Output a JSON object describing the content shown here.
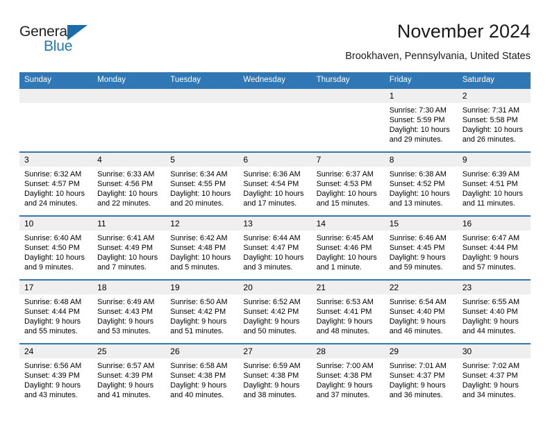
{
  "logo": {
    "word_top": "General",
    "word_bottom": "Blue",
    "triangle_color": "#1b6cab",
    "blue_color": "#2077b8",
    "dark_color": "#231f20"
  },
  "header": {
    "title": "November 2024",
    "subtitle": "Brookhaven, Pennsylvania, United States",
    "accent_color": "#3077b5",
    "daynum_band_color": "#efefef"
  },
  "weekdays": [
    "Sunday",
    "Monday",
    "Tuesday",
    "Wednesday",
    "Thursday",
    "Friday",
    "Saturday"
  ],
  "weeks": [
    [
      {
        "day": "",
        "sunrise": "",
        "sunset": "",
        "daylight": "",
        "empty": true
      },
      {
        "day": "",
        "sunrise": "",
        "sunset": "",
        "daylight": "",
        "empty": true
      },
      {
        "day": "",
        "sunrise": "",
        "sunset": "",
        "daylight": "",
        "empty": true
      },
      {
        "day": "",
        "sunrise": "",
        "sunset": "",
        "daylight": "",
        "empty": true
      },
      {
        "day": "",
        "sunrise": "",
        "sunset": "",
        "daylight": "",
        "empty": true
      },
      {
        "day": "1",
        "sunrise": "Sunrise: 7:30 AM",
        "sunset": "Sunset: 5:59 PM",
        "daylight": "Daylight: 10 hours and 29 minutes.",
        "empty": false
      },
      {
        "day": "2",
        "sunrise": "Sunrise: 7:31 AM",
        "sunset": "Sunset: 5:58 PM",
        "daylight": "Daylight: 10 hours and 26 minutes.",
        "empty": false
      }
    ],
    [
      {
        "day": "3",
        "sunrise": "Sunrise: 6:32 AM",
        "sunset": "Sunset: 4:57 PM",
        "daylight": "Daylight: 10 hours and 24 minutes.",
        "empty": false
      },
      {
        "day": "4",
        "sunrise": "Sunrise: 6:33 AM",
        "sunset": "Sunset: 4:56 PM",
        "daylight": "Daylight: 10 hours and 22 minutes.",
        "empty": false
      },
      {
        "day": "5",
        "sunrise": "Sunrise: 6:34 AM",
        "sunset": "Sunset: 4:55 PM",
        "daylight": "Daylight: 10 hours and 20 minutes.",
        "empty": false
      },
      {
        "day": "6",
        "sunrise": "Sunrise: 6:36 AM",
        "sunset": "Sunset: 4:54 PM",
        "daylight": "Daylight: 10 hours and 17 minutes.",
        "empty": false
      },
      {
        "day": "7",
        "sunrise": "Sunrise: 6:37 AM",
        "sunset": "Sunset: 4:53 PM",
        "daylight": "Daylight: 10 hours and 15 minutes.",
        "empty": false
      },
      {
        "day": "8",
        "sunrise": "Sunrise: 6:38 AM",
        "sunset": "Sunset: 4:52 PM",
        "daylight": "Daylight: 10 hours and 13 minutes.",
        "empty": false
      },
      {
        "day": "9",
        "sunrise": "Sunrise: 6:39 AM",
        "sunset": "Sunset: 4:51 PM",
        "daylight": "Daylight: 10 hours and 11 minutes.",
        "empty": false
      }
    ],
    [
      {
        "day": "10",
        "sunrise": "Sunrise: 6:40 AM",
        "sunset": "Sunset: 4:50 PM",
        "daylight": "Daylight: 10 hours and 9 minutes.",
        "empty": false
      },
      {
        "day": "11",
        "sunrise": "Sunrise: 6:41 AM",
        "sunset": "Sunset: 4:49 PM",
        "daylight": "Daylight: 10 hours and 7 minutes.",
        "empty": false
      },
      {
        "day": "12",
        "sunrise": "Sunrise: 6:42 AM",
        "sunset": "Sunset: 4:48 PM",
        "daylight": "Daylight: 10 hours and 5 minutes.",
        "empty": false
      },
      {
        "day": "13",
        "sunrise": "Sunrise: 6:44 AM",
        "sunset": "Sunset: 4:47 PM",
        "daylight": "Daylight: 10 hours and 3 minutes.",
        "empty": false
      },
      {
        "day": "14",
        "sunrise": "Sunrise: 6:45 AM",
        "sunset": "Sunset: 4:46 PM",
        "daylight": "Daylight: 10 hours and 1 minute.",
        "empty": false
      },
      {
        "day": "15",
        "sunrise": "Sunrise: 6:46 AM",
        "sunset": "Sunset: 4:45 PM",
        "daylight": "Daylight: 9 hours and 59 minutes.",
        "empty": false
      },
      {
        "day": "16",
        "sunrise": "Sunrise: 6:47 AM",
        "sunset": "Sunset: 4:44 PM",
        "daylight": "Daylight: 9 hours and 57 minutes.",
        "empty": false
      }
    ],
    [
      {
        "day": "17",
        "sunrise": "Sunrise: 6:48 AM",
        "sunset": "Sunset: 4:44 PM",
        "daylight": "Daylight: 9 hours and 55 minutes.",
        "empty": false
      },
      {
        "day": "18",
        "sunrise": "Sunrise: 6:49 AM",
        "sunset": "Sunset: 4:43 PM",
        "daylight": "Daylight: 9 hours and 53 minutes.",
        "empty": false
      },
      {
        "day": "19",
        "sunrise": "Sunrise: 6:50 AM",
        "sunset": "Sunset: 4:42 PM",
        "daylight": "Daylight: 9 hours and 51 minutes.",
        "empty": false
      },
      {
        "day": "20",
        "sunrise": "Sunrise: 6:52 AM",
        "sunset": "Sunset: 4:42 PM",
        "daylight": "Daylight: 9 hours and 50 minutes.",
        "empty": false
      },
      {
        "day": "21",
        "sunrise": "Sunrise: 6:53 AM",
        "sunset": "Sunset: 4:41 PM",
        "daylight": "Daylight: 9 hours and 48 minutes.",
        "empty": false
      },
      {
        "day": "22",
        "sunrise": "Sunrise: 6:54 AM",
        "sunset": "Sunset: 4:40 PM",
        "daylight": "Daylight: 9 hours and 46 minutes.",
        "empty": false
      },
      {
        "day": "23",
        "sunrise": "Sunrise: 6:55 AM",
        "sunset": "Sunset: 4:40 PM",
        "daylight": "Daylight: 9 hours and 44 minutes.",
        "empty": false
      }
    ],
    [
      {
        "day": "24",
        "sunrise": "Sunrise: 6:56 AM",
        "sunset": "Sunset: 4:39 PM",
        "daylight": "Daylight: 9 hours and 43 minutes.",
        "empty": false
      },
      {
        "day": "25",
        "sunrise": "Sunrise: 6:57 AM",
        "sunset": "Sunset: 4:39 PM",
        "daylight": "Daylight: 9 hours and 41 minutes.",
        "empty": false
      },
      {
        "day": "26",
        "sunrise": "Sunrise: 6:58 AM",
        "sunset": "Sunset: 4:38 PM",
        "daylight": "Daylight: 9 hours and 40 minutes.",
        "empty": false
      },
      {
        "day": "27",
        "sunrise": "Sunrise: 6:59 AM",
        "sunset": "Sunset: 4:38 PM",
        "daylight": "Daylight: 9 hours and 38 minutes.",
        "empty": false
      },
      {
        "day": "28",
        "sunrise": "Sunrise: 7:00 AM",
        "sunset": "Sunset: 4:38 PM",
        "daylight": "Daylight: 9 hours and 37 minutes.",
        "empty": false
      },
      {
        "day": "29",
        "sunrise": "Sunrise: 7:01 AM",
        "sunset": "Sunset: 4:37 PM",
        "daylight": "Daylight: 9 hours and 36 minutes.",
        "empty": false
      },
      {
        "day": "30",
        "sunrise": "Sunrise: 7:02 AM",
        "sunset": "Sunset: 4:37 PM",
        "daylight": "Daylight: 9 hours and 34 minutes.",
        "empty": false
      }
    ]
  ]
}
